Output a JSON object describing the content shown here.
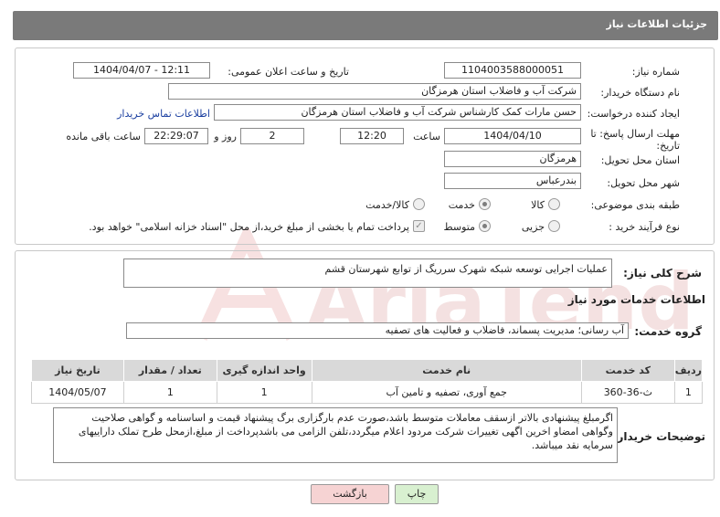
{
  "header": {
    "title": "جزئیات اطلاعات نیاز"
  },
  "form": {
    "need_number": {
      "label": "شماره نیاز:",
      "value": "1104003588000051"
    },
    "announce_datetime": {
      "label": "تاریخ و ساعت اعلان عمومی:",
      "value": "1404/04/07 - 12:11"
    },
    "buyer_org": {
      "label": "نام دستگاه خریدار:",
      "value": "شرکت آب و فاضلاب استان هرمزگان"
    },
    "requester": {
      "label": "ایجاد کننده درخواست:",
      "value": "حسن مارات کمک کارشناس شرکت آب و فاضلاب استان هرمزگان",
      "contact_link": "اطلاعات تماس خریدار"
    },
    "deadline": {
      "label_line1": "مهلت ارسال پاسخ: تا",
      "label_line2": "تاریخ:",
      "date": "1404/04/10",
      "time_label": "ساعت",
      "time": "12:20",
      "days": "2",
      "days_label": "روز و",
      "remaining": "22:29:07",
      "remaining_label": "ساعت باقی مانده"
    },
    "province": {
      "label": "استان محل تحویل:",
      "value": "هرمزگان"
    },
    "city": {
      "label": "شهر محل تحویل:",
      "value": "بندرعباس"
    },
    "category": {
      "label": "طبقه بندی موضوعی:",
      "options": [
        "کالا",
        "خدمت",
        "کالا/خدمت"
      ],
      "selected": "خدمت"
    },
    "purchase_type": {
      "label": "نوع فرآیند خرید :",
      "options": [
        "جزیی",
        "متوسط"
      ],
      "selected": "متوسط",
      "payment_note": "پرداخت تمام یا بخشی از مبلغ خرید،از محل \"اسناد خزانه اسلامی\" خواهد بود."
    }
  },
  "summary": {
    "label": "شرح کلی نیاز:",
    "value": "عملیات اجرایی توسعه شبکه شهرک سرریگ از توابع شهرستان قشم"
  },
  "services": {
    "section_title": "اطلاعات خدمات مورد نیاز",
    "group_label": "گروه خدمت:",
    "group_value": "آب رسانی؛ مدیریت پسماند، فاضلاب و فعالیت های تصفیه",
    "table": {
      "headers": [
        "ردیف",
        "کد خدمت",
        "نام خدمت",
        "واحد اندازه گیری",
        "تعداد / مقدار",
        "تاریخ نیاز"
      ],
      "rows": [
        [
          "1",
          "ث-36-360",
          "جمع آوری، تصفیه و تامین آب",
          "1",
          "1",
          "1404/05/07"
        ]
      ]
    }
  },
  "buyer_notes": {
    "label": "توضیحات خریدار:",
    "value": "اگرمبلغ پیشنهادی بالاتر ازسقف معاملات متوسط باشد،صورت عدم بارگزاری برگ پیشنهاد قیمت و اساسنامه و گواهی صلاحیت وگواهی امضاو اخرین اگهی تغییرات شرکت مردود اعلام میگردد،تلفن الزامی می باشدپرداخت از مبلغ،ازمحل طرح تملک داراییهای سرمایه نقد میباشد."
  },
  "buttons": {
    "print": "چاپ",
    "back": "بازگشت"
  },
  "watermark": {
    "text": "AriaTender.net"
  },
  "colors": {
    "header_bg": "#7a7a7a",
    "link": "#1b3fa0",
    "back_button": "#f6d3d3",
    "print_button": "#d8f0d0",
    "watermark": "#e9b9b9"
  }
}
